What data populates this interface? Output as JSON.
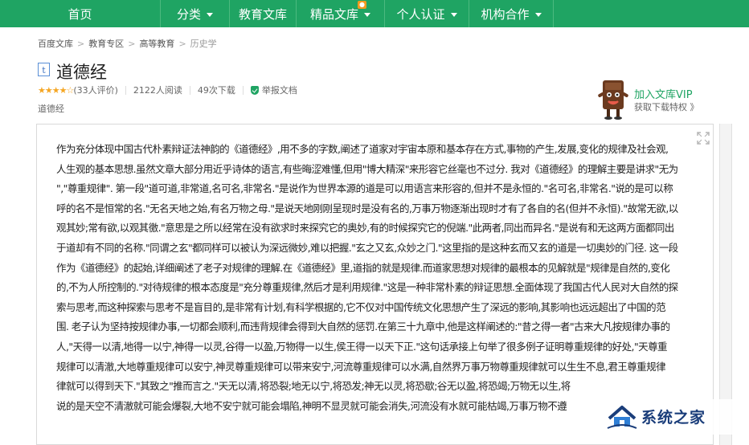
{
  "nav": {
    "items": [
      {
        "label": "首页",
        "dropdown": false
      },
      {
        "label": "分类",
        "dropdown": true
      },
      {
        "label": "教育文库",
        "dropdown": false
      },
      {
        "label": "精品文库",
        "dropdown": true
      },
      {
        "label": "个人认证",
        "dropdown": true
      },
      {
        "label": "机构合作",
        "dropdown": true
      }
    ],
    "accent_color": "#1fa463"
  },
  "breadcrumb": [
    "百度文库",
    "教育专区",
    "高等教育",
    "历史学"
  ],
  "doc": {
    "type_icon": "t",
    "title": "道德经",
    "stars": "★★★★☆",
    "rating_count": "(33人评价)",
    "reads": "2122人阅读",
    "downloads": "49次下载",
    "report": "举报文档",
    "tag": "道德经"
  },
  "vip": {
    "title": "加入文库VIP",
    "subtitle": "获取下载特权 》"
  },
  "content": {
    "lines": [
      "作为充分体现中国古代朴素辩证法神韵的《道德经》,用不多的字数,阐述了道家对宇宙本原和基本存在方式,事物的产生,发展,变化的规律及社会观,",
      "人生观的基本思想.虽然文章大部分用近乎诗体的语言,有些晦涩难懂,但用\"博大精深\"来形容它丝毫也不过分. 我对《道德经》的理解主要是讲求\"无为",
      "\",\"尊重规律\". 第一段\"道可道,非常道,名可名,非常名.\"是说作为世界本源的道是可以用语言来形容的,但并不是永恒的.\"名可名,非常名.\"说的是可以称",
      "呼的名不是恒常的名.\"无名天地之始,有名万物之母.\"是说天地刚刚呈现时是没有名的,万事万物逐渐出现时才有了各自的名(但并不永恒).\"故常无欲,以",
      "观其妙;常有欲,以观其徼.\"意思是之所以经常在没有欲求时来探究它的奥妙,有的时候探究它的倪端.\"此两者,同出而异名.\"是说有和无这两方面都同出",
      "于道却有不同的名称.\"同谓之玄\"都同样可以被认为深远微妙,难以把握.\"玄之又玄,众妙之门.\"这里指的是这种玄而又玄的道是一切奥妙的门径. 这一段",
      "作为《道德经》的起始,详细阐述了老子对规律的理解.在《道德经》里,道指的就是规律.而道家思想对规律的最根本的见解就是\"规律是自然的,变化",
      "的,不为人所控制的.\"对待规律的根本态度是\"充分尊重规律,然后才是利用规律.\"这是一种非常朴素的辩证思想.全面体现了我国古代人民对大自然的探",
      "索与思考,而这种探索与思考不是盲目的,是非常有计划,有科学根据的,它不仅对中国传统文化思想产生了深远的影响,其影响也远远超出了中国的范",
      "围. 老子认为坚持按规律办事,一切都会顺利,而违背规律会得到大自然的惩罚.在第三十九章中,他是这样阐述的:\"昔之得一者\"古来大凡按规律办事的",
      "人,\"天得一以清,地得一以宁,神得一以灵,谷得一以盈,万物得一以生,侯王得一以天下正.\"这句话承接上句举了很多例子证明尊重规律的好处,\"天尊重",
      "规律可以清澈,大地尊重规律可以安宁,神灵尊重规律可以带来安宁,河流尊重规律可以水满,自然界万事万物尊重规律就可以生生不息,君王尊重规律",
      "律就可以得到天下.\"其致之\"推而言之.\"天无以清,将恐裂;地无以宁,将恐发;神无以灵,将恐歇;谷无以盈,将恐竭;万物无以生,将",
      "说的是天空不清澈就可能会爆裂,大地不安宁就可能会塌陷,神明不显灵就可能会消失,河流没有水就可能枯竭,万事万物不遵"
    ]
  },
  "watermark": {
    "text": "系统之家"
  }
}
